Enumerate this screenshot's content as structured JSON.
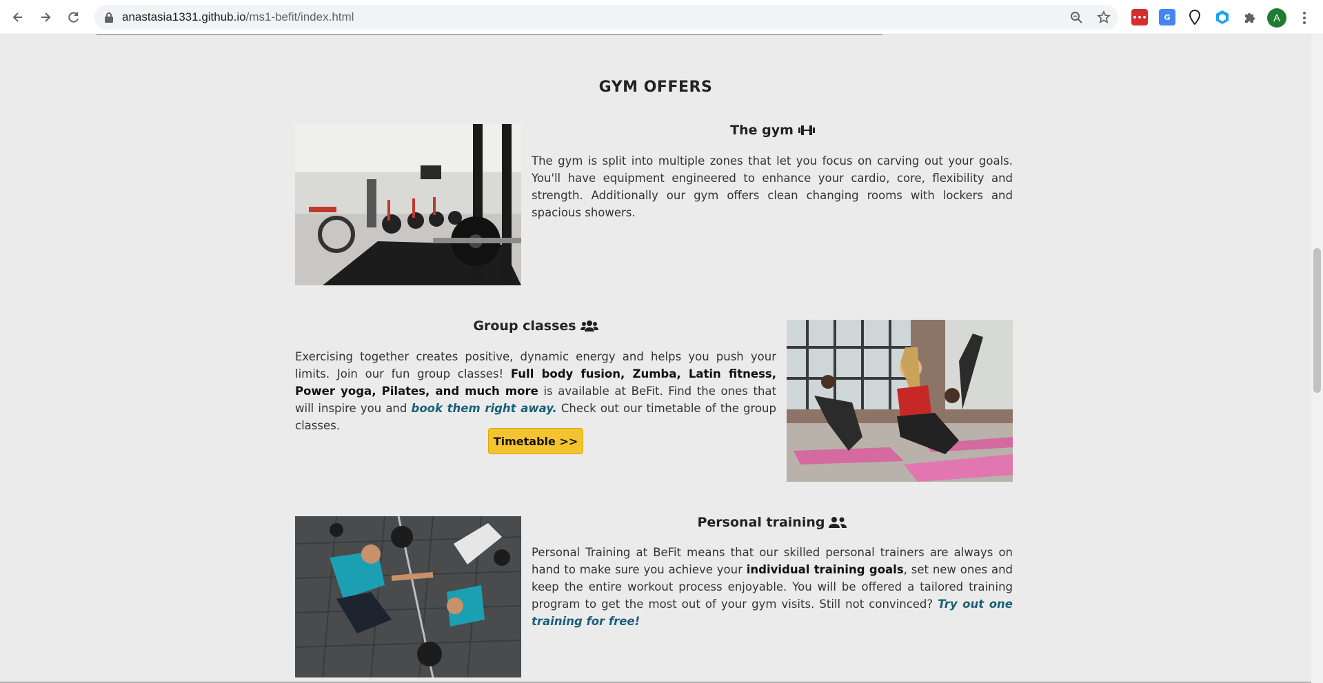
{
  "browser": {
    "url_domain": "anastasia1331.github.io",
    "url_path": "/ms1-befit/index.html",
    "profile_initial": "A",
    "icons": [
      "back-icon",
      "forward-icon",
      "reload-icon",
      "lock-icon",
      "zoom-icon",
      "star-icon",
      "extension-red-icon",
      "translate-icon",
      "location-pin-icon",
      "extension-blue-icon",
      "puzzle-icon",
      "menu-icon"
    ]
  },
  "section": {
    "title": "GYM OFFERS"
  },
  "gym": {
    "title": "The gym",
    "icon": "dumbbell-icon",
    "text": "The gym is split into multiple zones that let you focus on carving out your goals. You'll have equipment engineered to enhance your cardio, core, flexibility and strength. Additionally our gym offers clean changing rooms with lockers and spacious showers."
  },
  "group": {
    "title": "Group classes",
    "icon": "users-icon",
    "text_1": "Exercising together creates positive, dynamic energy and helps you push your limits. Join our fun group classes! ",
    "bold": "Full body fusion, Zumba, Latin fitness, Power yoga, Pilates, and much more",
    "text_2": " is available at BeFit. Find the ones that will inspire you and ",
    "link": "book them right away.",
    "text_3": " Check out our timetable of the group classes.",
    "button_label": "Timetable >>"
  },
  "personal": {
    "title": "Personal training",
    "icon": "user-friends-icon",
    "text_1": "Personal Training at BeFit means that our skilled personal trainers are always on hand to make sure you achieve your ",
    "bold": "individual training goals",
    "text_2": ", set new ones and keep the entire workout process enjoyable. You will be offered a tailored training program to get the most out of your gym visits. Still not convinced? ",
    "link": "Try out one training for free!"
  },
  "colors": {
    "page_bg": "#ebebeb",
    "button_bg": "#f4c430",
    "link": "#1a5f7a"
  }
}
